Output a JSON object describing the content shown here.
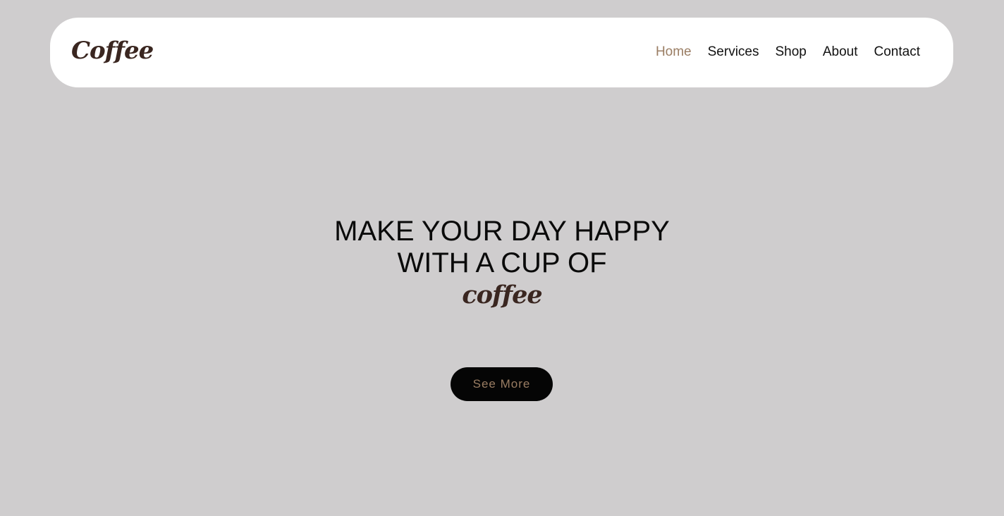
{
  "brand": {
    "logo_text": "Coffee"
  },
  "nav": {
    "items": [
      {
        "label": "Home",
        "active": true
      },
      {
        "label": "Services",
        "active": false
      },
      {
        "label": "Shop",
        "active": false
      },
      {
        "label": "About",
        "active": false
      },
      {
        "label": "Contact",
        "active": false
      }
    ]
  },
  "hero": {
    "title_line1": "MAKE YOUR DAY HAPPY",
    "title_line2": "WITH A CUP OF",
    "accent_word": "coffee",
    "cta_label": "See More"
  },
  "colors": {
    "background": "#cfcdce",
    "navbar": "#ffffff",
    "brand_brown": "#3a2620",
    "accent_tan": "#9a7d63",
    "button_bg": "#050505"
  }
}
